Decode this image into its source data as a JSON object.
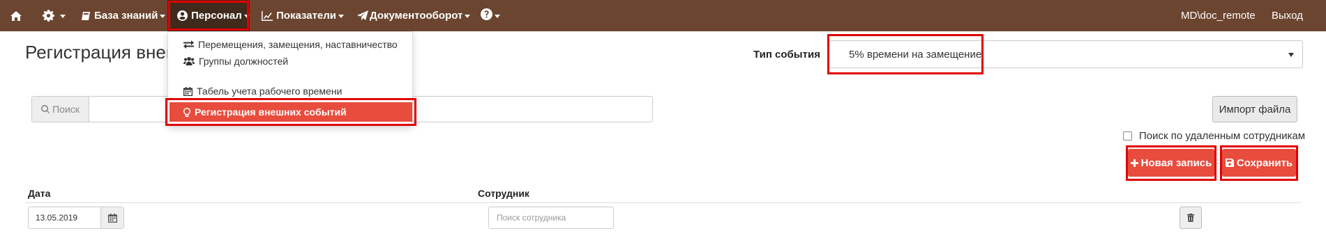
{
  "navbar": {
    "home_icon": "home-icon",
    "settings_icon": "gear-icon",
    "knowledge": "База знаний",
    "personnel": "Персонал",
    "metrics": "Показатели",
    "docflow": "Документооборот",
    "help_icon": "question-icon",
    "user": "MD\\doc_remote",
    "logout": "Выход"
  },
  "personnel_menu": {
    "items": [
      {
        "label": "Перемещения, замещения, наставничество",
        "icon": "exchange-icon"
      },
      {
        "label": "Группы должностей",
        "icon": "users-icon"
      },
      {
        "label": "Табель учета рабочего времени",
        "icon": "calendar-icon"
      },
      {
        "label": "Регистрация внешних событий",
        "icon": "lightbulb-icon"
      }
    ]
  },
  "page": {
    "title": "Регистрация внеш"
  },
  "event_type": {
    "label": "Тип события",
    "value": "5% времени на замещение"
  },
  "search": {
    "addon": "Поиск"
  },
  "import_button": "Импорт файла",
  "deleted_search_label": "Поиск по удаленным сотрудникам",
  "new_record_button": "Новая запись",
  "save_button": "Сохранить",
  "table": {
    "columns": [
      "Дата",
      "Сотрудник"
    ],
    "rows": [
      {
        "date": "13.05.2019",
        "employee_placeholder": "Поиск сотрудника"
      }
    ]
  },
  "colors": {
    "navbar": "#6b4530",
    "accent": "#e84c3d",
    "highlight": "#e00000"
  }
}
